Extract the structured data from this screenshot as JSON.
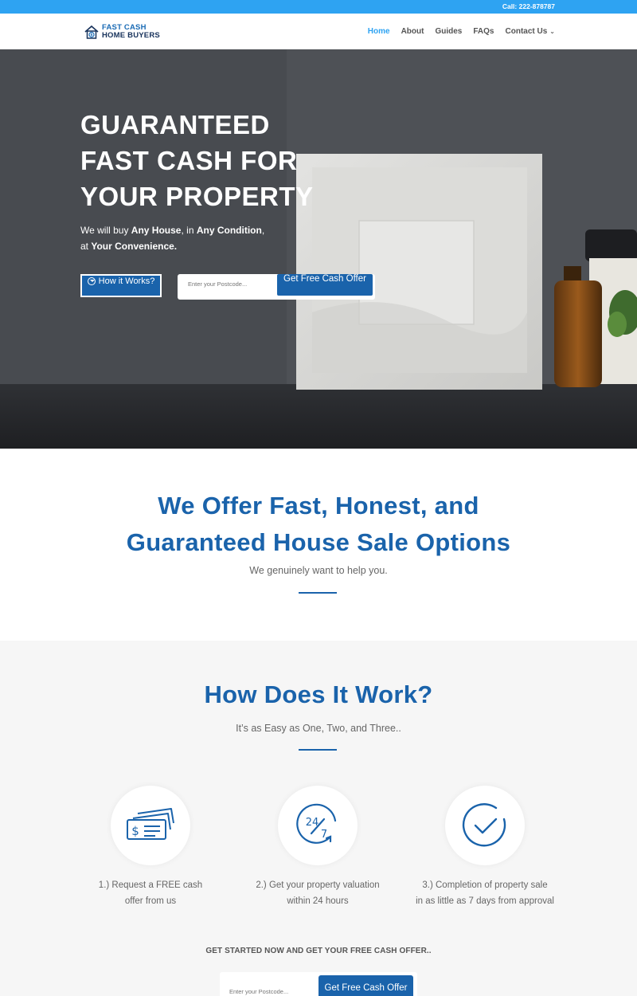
{
  "topbar": {
    "call": "Call: 222-878787"
  },
  "header": {
    "logo": {
      "line1": "FAST CASH",
      "line2": "HOME BUYERS"
    },
    "nav": [
      {
        "label": "Home",
        "active": true
      },
      {
        "label": "About"
      },
      {
        "label": "Guides"
      },
      {
        "label": "FAQs"
      },
      {
        "label": "Contact Us"
      }
    ]
  },
  "hero": {
    "title_lines": [
      "GUARANTEED",
      "FAST CASH FOR",
      "YOUR PROPERTY"
    ],
    "sub": {
      "p1": "We will buy ",
      "b1": "Any House",
      "p2": ", in ",
      "b2": "Any Condition",
      "p3": ",",
      "p4": "at ",
      "b3": "Your Convenience."
    },
    "how_button": "How it Works?",
    "postcode_placeholder": "Enter your Postcode...",
    "offer_button": "Get Free Cash Offer"
  },
  "offer": {
    "title_line1": "We Offer Fast, Honest, and",
    "title_line2": "Guaranteed House Sale Options",
    "sub": "We genuinely want to help you."
  },
  "how": {
    "title": "How Does It Work?",
    "sub": "It’s as Easy as One, Two, and Three..",
    "steps": [
      {
        "line1": "1.) Request a FREE cash",
        "line2": "offer from us"
      },
      {
        "line1": "2.) Get your property valuation",
        "line2": "within 24 hours"
      },
      {
        "line1": "3.) Completion of property sale",
        "line2": "in as little as 7 days from approval"
      }
    ],
    "cta_label": "GET STARTED NOW AND GET YOUR FREE CASH OFFER..",
    "postcode_placeholder": "Enter your Postcode...",
    "offer_button": "Get Free Cash Offer"
  },
  "colors": {
    "accent": "#2ea3f2",
    "brand": "#1a63ab"
  }
}
